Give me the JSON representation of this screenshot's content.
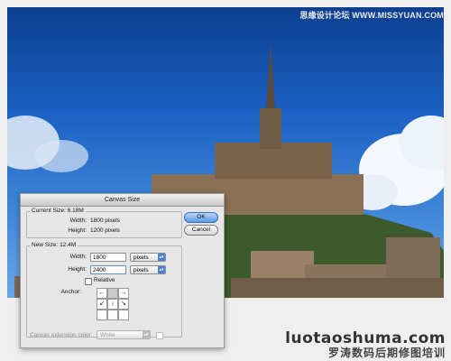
{
  "watermark": {
    "top": "思缘设计论坛 WWW.MISSYUAN.COM",
    "bottom_main": "luotaoshuma.com",
    "bottom_sub": "罗涛数码后期修图培训"
  },
  "dialog": {
    "title": "Canvas Size",
    "current": {
      "label": "Current Size: 6.18M",
      "width_label": "Width:",
      "width_value": "1800 pixels",
      "height_label": "Height:",
      "height_value": "1200 pixels"
    },
    "new": {
      "label": "New Size: 12.4M",
      "width_label": "Width:",
      "width_value": "1800",
      "width_unit": "pixels",
      "height_label": "Height:",
      "height_value": "2400",
      "height_unit": "pixels",
      "relative_label": "Relative",
      "anchor_label": "Anchor:"
    },
    "ext_label": "Canvas extension color:",
    "ext_value": "White",
    "ok_label": "OK",
    "cancel_label": "Cancel",
    "anchor_arrows": [
      "←",
      "",
      "→",
      "↙",
      "↓",
      "↘",
      "",
      "",
      ""
    ]
  }
}
